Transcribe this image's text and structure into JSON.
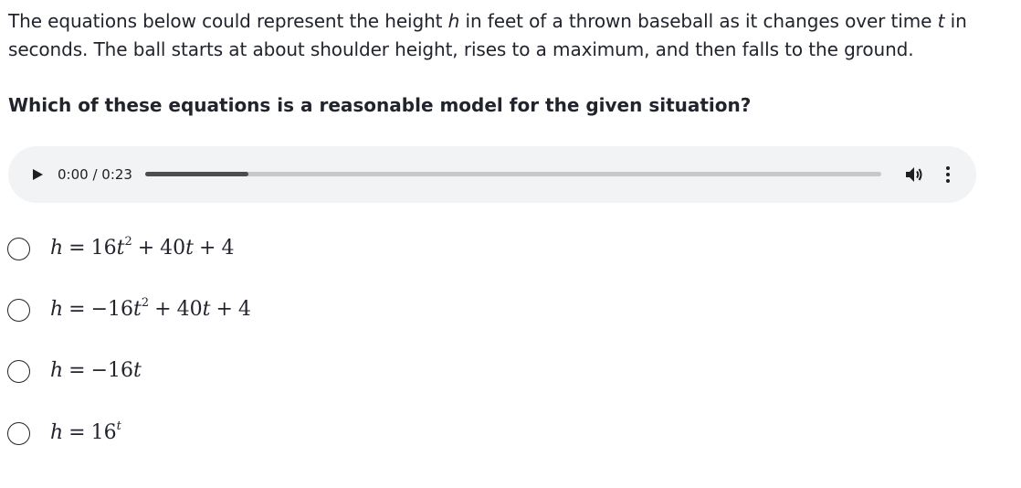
{
  "prompt": {
    "line1_before": "The equations below could represent the height",
    "var_h": "h",
    "line1_mid": "in feet of a thrown baseball as it changes over time",
    "var_t": "t",
    "line1_after": "in",
    "line2": "seconds. The ball starts at about shoulder height, rises to a maximum, and then falls to the ground."
  },
  "question": "Which of these equations is a reasonable model for the given situation?",
  "audio_player": {
    "time_display": "0:00 / 0:23",
    "progress_fraction": 0.14,
    "icons": [
      "play-icon",
      "volume-icon",
      "more-vertical-icon"
    ]
  },
  "choices": [
    {
      "lhs": "h",
      "eq": "=",
      "a": "16t",
      "a_exp": "2",
      "op1": "+",
      "b": "40t",
      "op2": "+",
      "c": "4"
    },
    {
      "lhs": "h",
      "eq": "=",
      "a": "−16t",
      "a_exp": "2",
      "op1": "+",
      "b": "40t",
      "op2": "+",
      "c": "4"
    },
    {
      "lhs": "h",
      "eq": "=",
      "a": "−16t"
    },
    {
      "lhs": "h",
      "eq": "=",
      "a": "16",
      "a_exp": "t"
    }
  ]
}
